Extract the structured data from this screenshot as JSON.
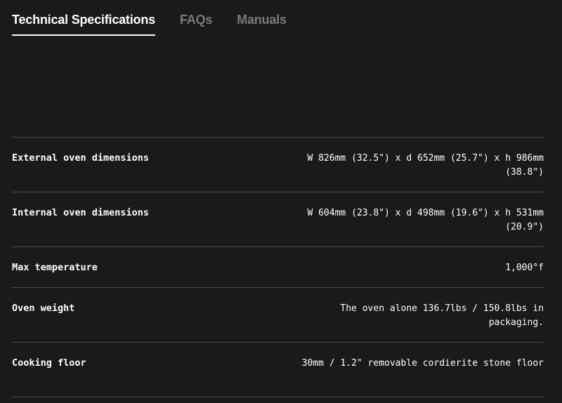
{
  "tabs": [
    {
      "label": "Technical Specifications",
      "active": true
    },
    {
      "label": "FAQs",
      "active": false
    },
    {
      "label": "Manuals",
      "active": false
    }
  ],
  "specs": [
    {
      "label": "External oven dimensions",
      "value": "W 826mm (32.5\") x d 652mm (25.7\") x h 986mm (38.8\")"
    },
    {
      "label": "Internal oven dimensions",
      "value": "W 604mm (23.8\") x d 498mm (19.6\") x h 531mm (20.9\")"
    },
    {
      "label": "Max temperature",
      "value": "1,000°f"
    },
    {
      "label": "Oven weight",
      "value": "The oven alone 136.7lbs / 150.8lbs in packaging."
    },
    {
      "label": "Cooking floor",
      "value": "30mm / 1.2\" removable cordierite stone floor"
    }
  ],
  "colors": {
    "background": "#1a1a1a",
    "text": "#ffffff",
    "inactive_tab": "#7a7a7a",
    "divider": "#4a4a4a"
  }
}
